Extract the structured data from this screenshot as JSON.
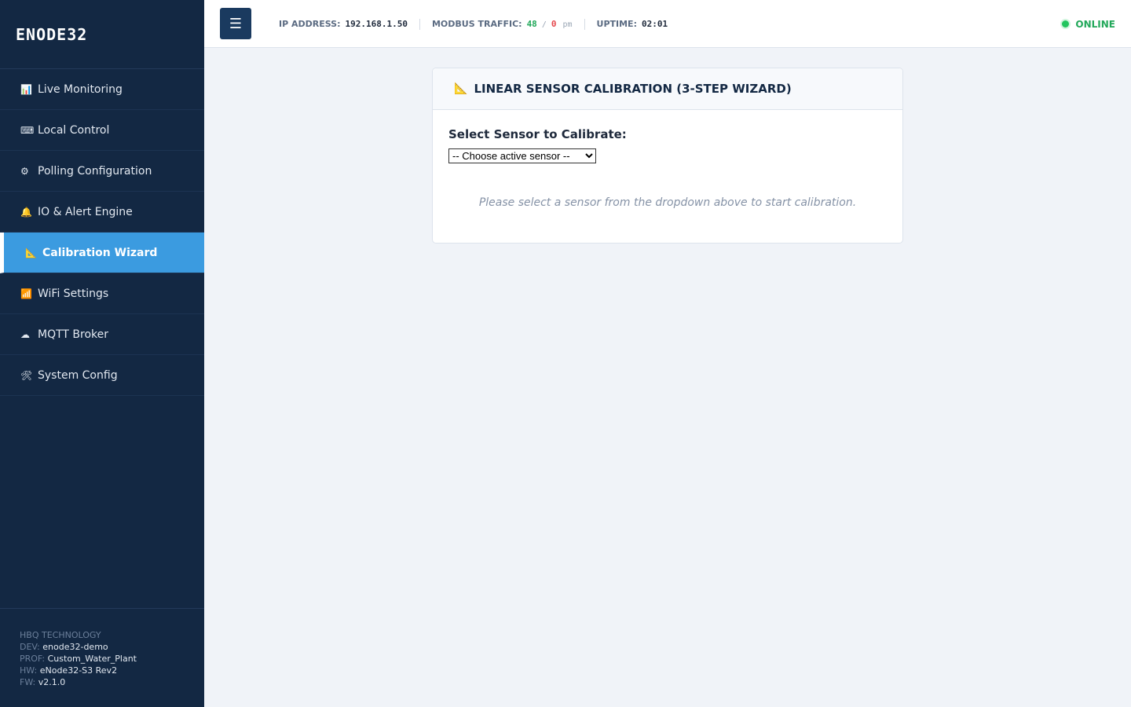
{
  "brand": "ENODE32",
  "nav": [
    {
      "icon": "📊",
      "label": "Live Monitoring"
    },
    {
      "icon": "⌨",
      "label": "Local Control"
    },
    {
      "icon": "⚙",
      "label": "Polling Configuration"
    },
    {
      "icon": "🔔",
      "label": "IO & Alert Engine"
    },
    {
      "icon": "📐",
      "label": "Calibration Wizard"
    },
    {
      "icon": "📶",
      "label": "WiFi Settings"
    },
    {
      "icon": "☁",
      "label": "MQTT Broker"
    },
    {
      "icon": "🛠",
      "label": "System Config"
    }
  ],
  "footer": {
    "company": "HBQ TECHNOLOGY",
    "dev_label": "DEV:",
    "dev": "enode32-demo",
    "prof_label": "PROF:",
    "prof": "Custom_Water_Plant",
    "hw_label": "HW:",
    "hw": "eNode32-S3 Rev2",
    "fw_label": "FW:",
    "fw": "v2.1.0"
  },
  "topbar": {
    "menu_icon": "☰",
    "ip_label": "IP ADDRESS:",
    "ip": "192.168.1.50",
    "traffic_label": "MODBUS TRAFFIC:",
    "traffic_ok": "48",
    "traffic_slash": "/",
    "traffic_err": "0",
    "traffic_unit": "pm",
    "uptime_label": "UPTIME:",
    "uptime": "02:01",
    "status": "ONLINE"
  },
  "card": {
    "icon": "📐",
    "title": "LINEAR SENSOR CALIBRATION (3-STEP WIZARD)",
    "select_label": "Select Sensor to Calibrate:",
    "select_value": "-- Choose active sensor --",
    "hint": "Please select a sensor from the dropdown above to start calibration."
  },
  "colors": {
    "sidebar": "#132843",
    "active": "#3b9be0",
    "online": "#22a85a",
    "error": "#e5484d"
  }
}
